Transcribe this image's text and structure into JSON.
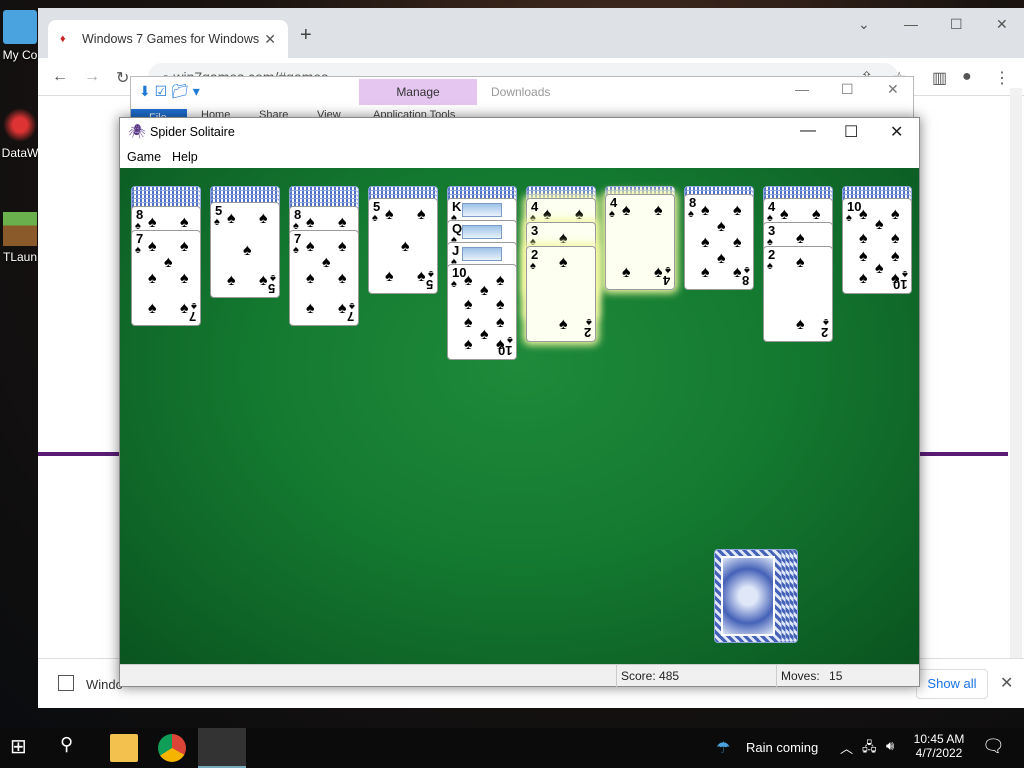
{
  "desktop": {
    "icons": [
      {
        "label": "My Co",
        "name": "my-computer"
      },
      {
        "label": "DataW",
        "name": "dataw"
      },
      {
        "label": "TLaun",
        "name": "tlauncher"
      }
    ]
  },
  "browser": {
    "tab_title": "Windows 7 Games for Windows",
    "url": "win7games.com/#games",
    "download_item": "Windo",
    "show_all": "Show all"
  },
  "explorer": {
    "manage": "Manage",
    "downloads": "Downloads",
    "ribbon": [
      "File",
      "Home",
      "Share",
      "View",
      "Application Tools"
    ]
  },
  "spider": {
    "title": "Spider Solitaire",
    "menu": [
      "Game",
      "Help"
    ],
    "score_label": "Score:",
    "score": "485",
    "moves_label": "Moves:",
    "moves": "15",
    "columns": [
      {
        "hidden": 5,
        "up": [
          "8",
          "7"
        ]
      },
      {
        "hidden": 4,
        "up": [
          "5"
        ]
      },
      {
        "hidden": 5,
        "up": [
          "8",
          "7"
        ]
      },
      {
        "hidden": 3,
        "up": [
          "5"
        ]
      },
      {
        "hidden": 3,
        "up": [
          "K",
          "Q",
          "J",
          "10"
        ]
      },
      {
        "hidden": 3,
        "up": [
          "4",
          "3",
          "2"
        ],
        "highlight": true
      },
      {
        "hidden": 2,
        "up": [
          "4"
        ],
        "highlight": true
      },
      {
        "hidden": 2,
        "up": [
          "8"
        ]
      },
      {
        "hidden": 3,
        "up": [
          "4",
          "3",
          "2"
        ]
      },
      {
        "hidden": 3,
        "up": [
          "10"
        ]
      }
    ],
    "suit": "♠"
  },
  "taskbar": {
    "weather": "Rain coming",
    "time": "10:45 AM",
    "date": "4/7/2022"
  }
}
